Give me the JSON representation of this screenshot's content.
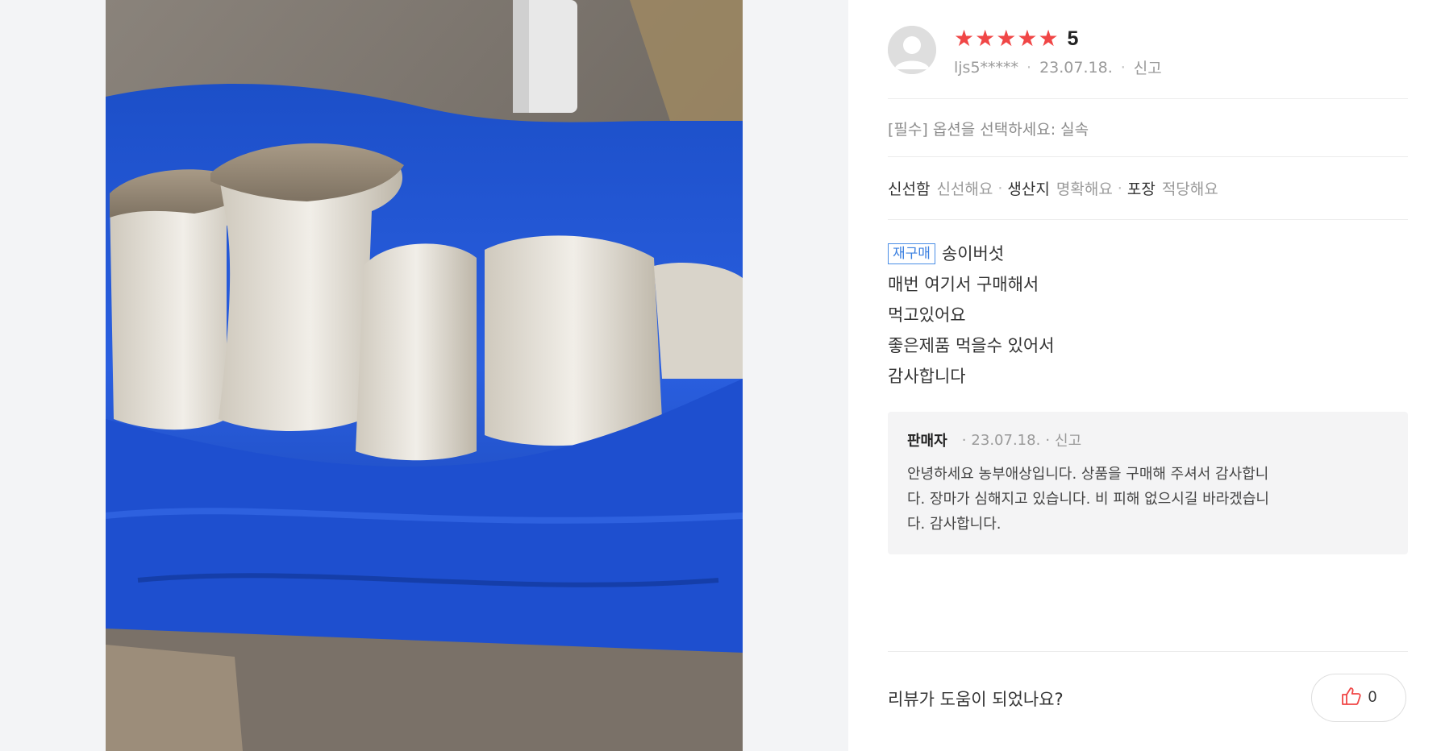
{
  "review": {
    "rating": 5,
    "rating_text": "5",
    "reviewer": "ljs5*****",
    "date": "23.07.18.",
    "report": "신고",
    "option": "[필수] 옵션을 선택하세요: 실속",
    "attributes": [
      {
        "key": "신선함",
        "value": "신선해요"
      },
      {
        "key": "생산지",
        "value": "명확해요"
      },
      {
        "key": "포장",
        "value": "적당해요"
      }
    ],
    "tag": "재구매",
    "lines": [
      "송이버섯",
      "매번 여기서 구매해서",
      "먹고있어요",
      "좋은제품 먹을수 있어서",
      "감사합니다"
    ]
  },
  "reply": {
    "seller": "판매자",
    "date": "23.07.18.",
    "report": "신고",
    "text_lines": [
      "안녕하세요 농부애상입니다. 상품을 구매해 주셔서 감사합니",
      "다. 장마가 심해지고 있습니다. 비 피해 없으시길 바라겠습니",
      "다. 감사합니다."
    ]
  },
  "helpful": {
    "question": "리뷰가 도움이 되었나요?",
    "count": "0"
  },
  "icons": {
    "star": "star-icon",
    "avatar": "user-avatar-icon",
    "like": "thumbs-up-icon"
  },
  "colors": {
    "star": "#f04646",
    "tag": "#3a7fe0",
    "like_icon": "#f04646"
  }
}
